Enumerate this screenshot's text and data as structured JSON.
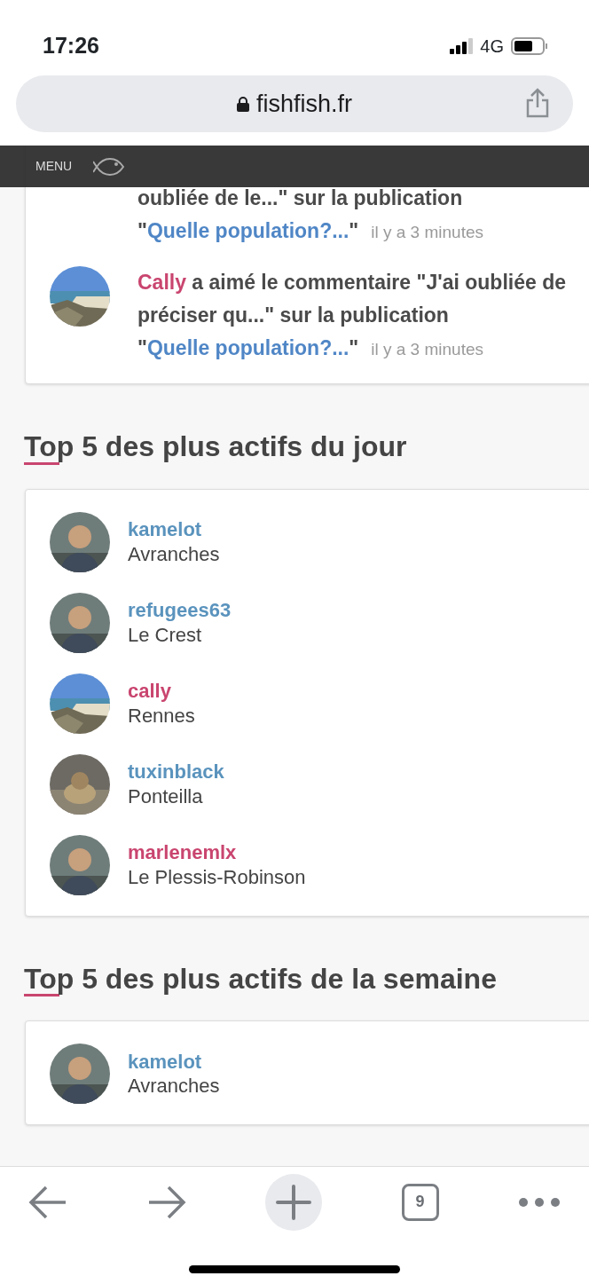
{
  "status_bar": {
    "time": "17:26",
    "network": "4G"
  },
  "address_bar": {
    "url": "fishfish.fr"
  },
  "site_header": {
    "menu_label": "MENU"
  },
  "activity": [
    {
      "text": "oubliée de le...\" sur la publication \"",
      "publication": "Quelle population?...",
      "after": "\"",
      "time": "il y a 3 minutes"
    },
    {
      "user": "Cally",
      "color": "#c9456f",
      "text": " a aimé le commentaire \"J'ai oubliée de préciser qu...\" sur la publication \"",
      "publication": "Quelle population?...",
      "after": "\"",
      "time": "il y a 3 minutes"
    }
  ],
  "sections": [
    {
      "title": "Top 5 des plus actifs du jour",
      "members": [
        {
          "name": "kamelot",
          "color": "#5a93bd",
          "city": "Avranches"
        },
        {
          "name": "refugees63",
          "color": "#5a93bd",
          "city": "Le Crest"
        },
        {
          "name": "cally",
          "color": "#c9456f",
          "city": "Rennes"
        },
        {
          "name": "tuxinblack",
          "color": "#5a93bd",
          "city": "Ponteilla"
        },
        {
          "name": "marlenemlx",
          "color": "#c9456f",
          "city": "Le Plessis-Robinson"
        }
      ]
    },
    {
      "title": "Top 5 des plus actifs de la semaine",
      "members": [
        {
          "name": "kamelot",
          "color": "#5a93bd",
          "city": "Avranches"
        }
      ]
    }
  ],
  "toolbar": {
    "tab_count": "9"
  }
}
